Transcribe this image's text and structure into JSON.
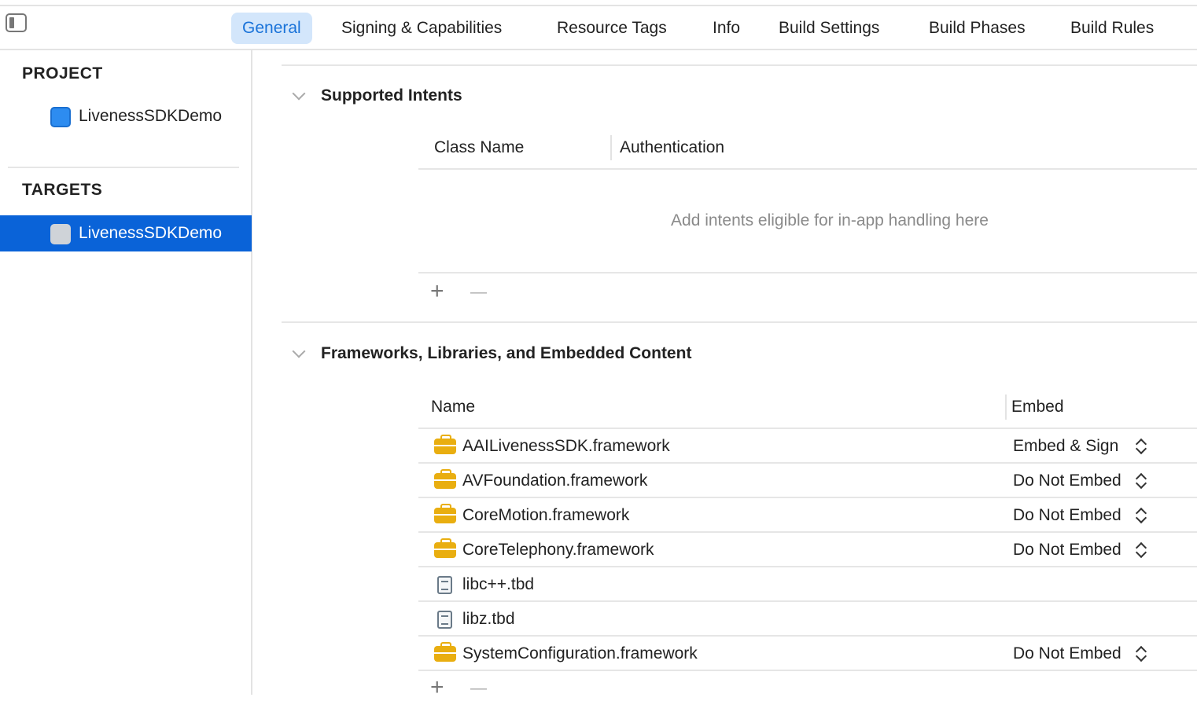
{
  "tabs": [
    "General",
    "Signing & Capabilities",
    "Resource Tags",
    "Info",
    "Build Settings",
    "Build Phases",
    "Build Rules"
  ],
  "sidebar": {
    "project_header": "PROJECT",
    "project_item": "LivenessSDKDemo",
    "targets_header": "TARGETS",
    "target_item": "LivenessSDKDemo"
  },
  "intents": {
    "title": "Supported Intents",
    "col_class": "Class Name",
    "col_auth": "Authentication",
    "placeholder": "Add intents eligible for in-app handling here",
    "add": "+",
    "remove": "—"
  },
  "frameworks": {
    "title": "Frameworks, Libraries, and Embedded Content",
    "col_name": "Name",
    "col_embed": "Embed",
    "add": "+",
    "remove": "—",
    "rows": [
      {
        "name": "AAILivenessSDK.framework",
        "embed": "Embed & Sign",
        "icon": "framework-icon"
      },
      {
        "name": "AVFoundation.framework",
        "embed": "Do Not Embed",
        "icon": "framework-icon"
      },
      {
        "name": "CoreMotion.framework",
        "embed": "Do Not Embed",
        "icon": "framework-icon"
      },
      {
        "name": "CoreTelephony.framework",
        "embed": "Do Not Embed",
        "icon": "framework-icon"
      },
      {
        "name": "libc++.tbd",
        "embed": "",
        "icon": "tbd-file-icon"
      },
      {
        "name": "libz.tbd",
        "embed": "",
        "icon": "tbd-file-icon"
      },
      {
        "name": "SystemConfiguration.framework",
        "embed": "Do Not Embed",
        "icon": "framework-icon"
      }
    ]
  },
  "colors": {
    "accent": "#0a63d8",
    "tab_active_bg": "#d3e6fb",
    "framework": "#e9ae10"
  }
}
